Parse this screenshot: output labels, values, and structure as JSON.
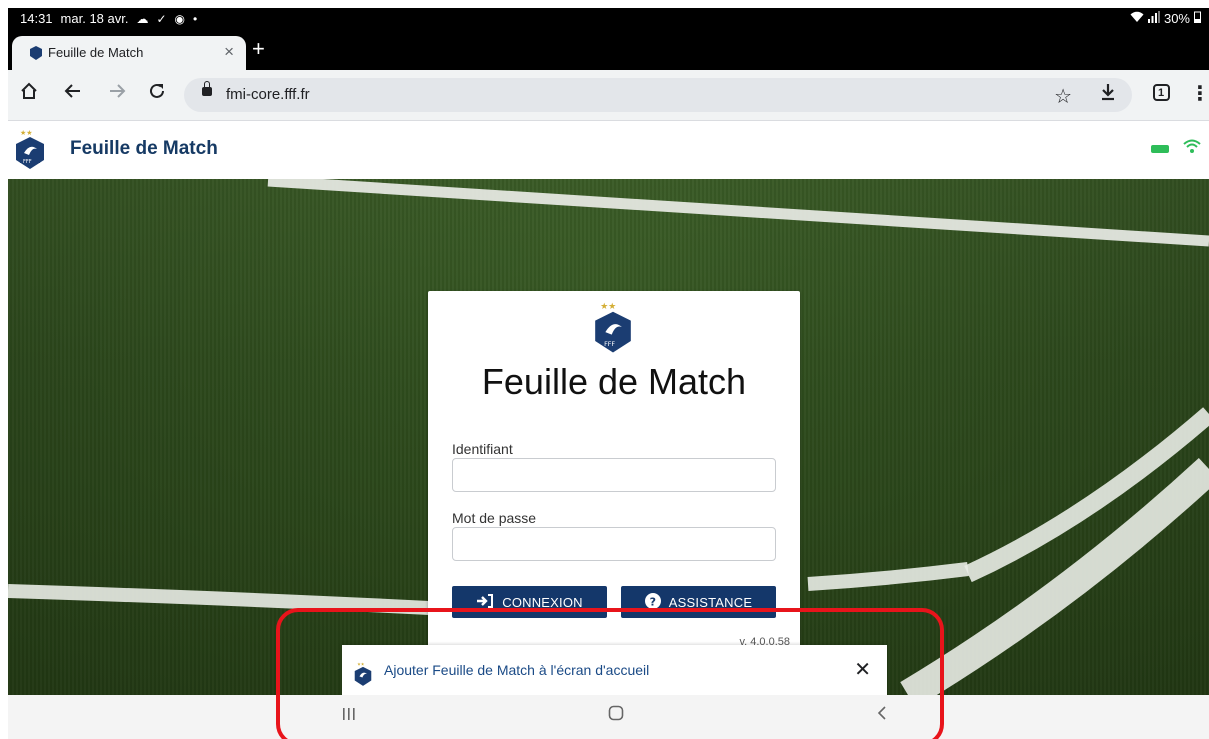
{
  "status_bar": {
    "time": "14:31",
    "date": "mar. 18 avr.",
    "battery": "30%"
  },
  "tab": {
    "title": "Feuille de Match",
    "close_glyph": "×",
    "new_tab_glyph": "+"
  },
  "toolbar": {
    "url": "fmi-core.fff.fr",
    "tab_count": "1"
  },
  "site_header": {
    "title": "Feuille de Match"
  },
  "login": {
    "heading": "Feuille de Match",
    "identifiant_label": "Identifiant",
    "identifiant_value": "",
    "password_label": "Mot de passe",
    "password_value": "",
    "connexion_label": "CONNEXION",
    "assistance_label": "ASSISTANCE",
    "version": "v. 4.0.0.58"
  },
  "add_to_home": {
    "text": "Ajouter Feuille de Match à l'écran d'accueil"
  },
  "colors": {
    "brand_navy": "#14376a",
    "header_title": "#163a64",
    "highlight_red": "#e8141b",
    "status_green": "#2ebd59"
  },
  "icons": {
    "home": "home-icon",
    "back": "back-arrow-icon",
    "forward": "forward-arrow-icon",
    "reload": "reload-icon",
    "lock": "lock-icon",
    "star": "bookmark-star-icon",
    "download": "download-icon",
    "menu": "more-vert-icon"
  }
}
